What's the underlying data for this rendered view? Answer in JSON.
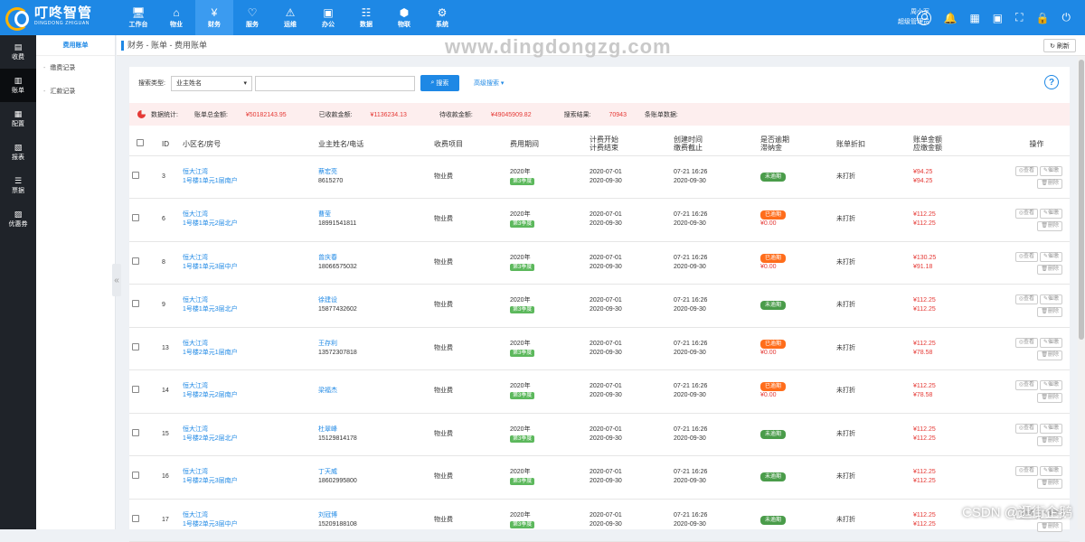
{
  "brand": {
    "name_cn": "叮咚智管",
    "name_en": "DINGDONG ZHIGUAN"
  },
  "nav": [
    {
      "icon": "desktop-icon",
      "glyph": "🖥",
      "label": "工作台"
    },
    {
      "icon": "home-icon",
      "glyph": "⌂",
      "label": "物业"
    },
    {
      "icon": "money-bag-icon",
      "glyph": "¥",
      "label": "财务",
      "active": true
    },
    {
      "icon": "heart-icon",
      "glyph": "♡",
      "label": "服务"
    },
    {
      "icon": "ops-icon",
      "glyph": "⚠",
      "label": "运维"
    },
    {
      "icon": "briefcase-icon",
      "glyph": "▣",
      "label": "办公"
    },
    {
      "icon": "database-icon",
      "glyph": "☷",
      "label": "数据"
    },
    {
      "icon": "cube-icon",
      "glyph": "⬢",
      "label": "物联"
    },
    {
      "icon": "gear-icon",
      "glyph": "⚙",
      "label": "系统"
    }
  ],
  "user": {
    "name": "周小军",
    "role": "超级管理员"
  },
  "side": [
    {
      "icon": "receipt-icon",
      "glyph": "▤",
      "label": "收费"
    },
    {
      "icon": "bill-icon",
      "glyph": "▥",
      "label": "账单",
      "active": true
    },
    {
      "icon": "config-icon",
      "glyph": "▦",
      "label": "配置"
    },
    {
      "icon": "report-icon",
      "glyph": "▧",
      "label": "报表"
    },
    {
      "icon": "list-icon",
      "glyph": "☰",
      "label": "票据"
    },
    {
      "icon": "coupon-icon",
      "glyph": "▨",
      "label": "优惠券"
    }
  ],
  "subnav": {
    "active": "费用账单",
    "items": [
      "缴费记录",
      "汇款记录"
    ]
  },
  "breadcrumb": "财务 - 账单 - 费用账单",
  "watermark": "www.dingdongzg.com",
  "refresh": "刷新",
  "search": {
    "label": "搜索类型:",
    "select": "业主姓名",
    "button": "搜索",
    "advanced": "高级搜索"
  },
  "stats": {
    "label": "数据统计:",
    "total": "账单总金额:",
    "total_val": "¥50182143.95",
    "received": "已收款金额:",
    "received_val": "¥1136234.13",
    "pending": "待收款金额:",
    "pending_val": "¥49045909.82",
    "result_pre": "搜索结果:",
    "result_val": "70943",
    "result_post": "条账单数据:"
  },
  "columns": {
    "id": "ID",
    "community": "小区名/房号",
    "owner": "业主姓名/电话",
    "item": "收费项目",
    "period": "费用期间",
    "bill_start": "计费开始",
    "bill_end": "计费结束",
    "created": "创建时间",
    "due": "缴费截止",
    "overdue": "是否逾期",
    "late_fee": "滞纳金",
    "discount": "账单折扣",
    "bill_amount": "账单金额",
    "due_amount": "应缴金额",
    "ops": "操作"
  },
  "rows": [
    {
      "id": "3",
      "community": "恒大江湾",
      "room": "1号楼1单元1层南户",
      "owner": "蔡宏亮",
      "phone": "8615270",
      "item": "物业费",
      "year": "2020年",
      "quarter": "第3季度",
      "start": "2020-07-01",
      "end": "2020-09-30",
      "created": "07-21 16:26",
      "due": "2020-09-30",
      "status": "未逾期",
      "overdue": false,
      "fee": "",
      "discount": "未打折",
      "amount": "¥94.25",
      "pay": "¥94.25"
    },
    {
      "id": "6",
      "community": "恒大江湾",
      "room": "1号楼1单元2层北户",
      "owner": "曹莹",
      "phone": "18991541811",
      "item": "物业费",
      "year": "2020年",
      "quarter": "第3季度",
      "start": "2020-07-01",
      "end": "2020-09-30",
      "created": "07-21 16:26",
      "due": "2020-09-30",
      "status": "已逾期",
      "overdue": true,
      "fee": "¥0.00",
      "discount": "未打折",
      "amount": "¥112.25",
      "pay": "¥112.25"
    },
    {
      "id": "8",
      "community": "恒大江湾",
      "room": "1号楼1单元3层中户",
      "owner": "曾庆春",
      "phone": "18066575032",
      "item": "物业费",
      "year": "2020年",
      "quarter": "第3季度",
      "start": "2020-07-01",
      "end": "2020-09-30",
      "created": "07-21 16:26",
      "due": "2020-09-30",
      "status": "已逾期",
      "overdue": true,
      "fee": "¥0.00",
      "discount": "未打折",
      "amount": "¥130.25",
      "pay": "¥91.18"
    },
    {
      "id": "9",
      "community": "恒大江湾",
      "room": "1号楼1单元3层北户",
      "owner": "徐建设",
      "phone": "15877432602",
      "item": "物业费",
      "year": "2020年",
      "quarter": "第3季度",
      "start": "2020-07-01",
      "end": "2020-09-30",
      "created": "07-21 16:26",
      "due": "2020-09-30",
      "status": "未逾期",
      "overdue": false,
      "fee": "",
      "discount": "未打折",
      "amount": "¥112.25",
      "pay": "¥112.25"
    },
    {
      "id": "13",
      "community": "恒大江湾",
      "room": "1号楼2单元1层南户",
      "owner": "王存利",
      "phone": "13572307818",
      "item": "物业费",
      "year": "2020年",
      "quarter": "第3季度",
      "start": "2020-07-01",
      "end": "2020-09-30",
      "created": "07-21 16:26",
      "due": "2020-09-30",
      "status": "已逾期",
      "overdue": true,
      "fee": "¥0.00",
      "discount": "未打折",
      "amount": "¥112.25",
      "pay": "¥78.58"
    },
    {
      "id": "14",
      "community": "恒大江湾",
      "room": "1号楼2单元2层南户",
      "owner": "梁福杰",
      "phone": "",
      "item": "物业费",
      "year": "2020年",
      "quarter": "第3季度",
      "start": "2020-07-01",
      "end": "2020-09-30",
      "created": "07-21 16:26",
      "due": "2020-09-30",
      "status": "已逾期",
      "overdue": true,
      "fee": "¥0.00",
      "discount": "未打折",
      "amount": "¥112.25",
      "pay": "¥78.58"
    },
    {
      "id": "15",
      "community": "恒大江湾",
      "room": "1号楼2单元2层北户",
      "owner": "杜翠峰",
      "phone": "15129814178",
      "item": "物业费",
      "year": "2020年",
      "quarter": "第3季度",
      "start": "2020-07-01",
      "end": "2020-09-30",
      "created": "07-21 16:26",
      "due": "2020-09-30",
      "status": "未逾期",
      "overdue": false,
      "fee": "",
      "discount": "未打折",
      "amount": "¥112.25",
      "pay": "¥112.25"
    },
    {
      "id": "16",
      "community": "恒大江湾",
      "room": "1号楼2单元3层南户",
      "owner": "丁天威",
      "phone": "18602995800",
      "item": "物业费",
      "year": "2020年",
      "quarter": "第3季度",
      "start": "2020-07-01",
      "end": "2020-09-30",
      "created": "07-21 16:26",
      "due": "2020-09-30",
      "status": "未逾期",
      "overdue": false,
      "fee": "",
      "discount": "未打折",
      "amount": "¥112.25",
      "pay": "¥112.25"
    },
    {
      "id": "17",
      "community": "恒大江湾",
      "room": "1号楼2单元3层中户",
      "owner": "刘冠博",
      "phone": "15209188108",
      "item": "物业费",
      "year": "2020年",
      "quarter": "第3季度",
      "start": "2020-07-01",
      "end": "2020-09-30",
      "created": "07-21 16:26",
      "due": "2020-09-30",
      "status": "未逾期",
      "overdue": false,
      "fee": "",
      "discount": "未打折",
      "amount": "¥112.25",
      "pay": "¥112.25"
    }
  ],
  "ops": {
    "view": "查看",
    "remind": "催缴",
    "delete": "删除"
  },
  "credit": "CSDN @逛街企鹅"
}
